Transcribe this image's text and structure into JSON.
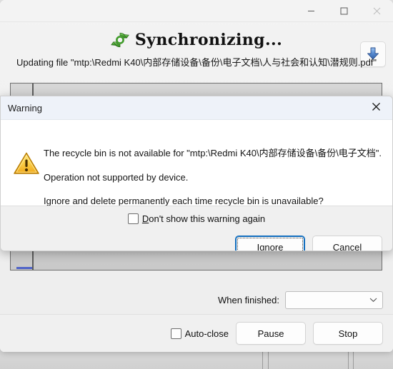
{
  "window": {
    "title_text": "Synchronizing...",
    "sync_icon": "sync-refresh-icon",
    "status_text": "Updating file \"mtp:\\Redmi K40\\内部存储设备\\备份\\电子文档\\人与社会和认知\\潜规则.pdf\"",
    "caption": {
      "minimize": "—",
      "maximize": "maximize-icon",
      "close": "close-icon"
    },
    "download_button_icon": "download-arrow-icon",
    "when_finished": {
      "label": "When finished:",
      "value": "",
      "placeholder": ""
    },
    "footer": {
      "auto_close_label": "Auto-close",
      "auto_close_checked": false,
      "pause_label": "Pause",
      "stop_label": "Stop"
    }
  },
  "dialog": {
    "title": "Warning",
    "close_icon": "close-icon",
    "icon": "warning-triangle-icon",
    "messages": [
      "The recycle bin is not available for \"mtp:\\Redmi K40\\内部存储设备\\备份\\电子文档\".",
      "Operation not supported by device.",
      "Ignore and delete permanently each time recycle bin is unavailable?"
    ],
    "dont_show": {
      "mnemonic": "D",
      "rest": "on't show this warning again",
      "checked": false
    },
    "buttons": {
      "ignore_mnemonic": "I",
      "ignore_rest": "gnore",
      "cancel_label": "Cancel"
    }
  },
  "colors": {
    "accent": "#0f6cbd",
    "warning": "#f5c016",
    "sync_green": "#3da02c",
    "progress_blue": "#4f63c8",
    "dialog_titlebar": "#eef2f9"
  }
}
